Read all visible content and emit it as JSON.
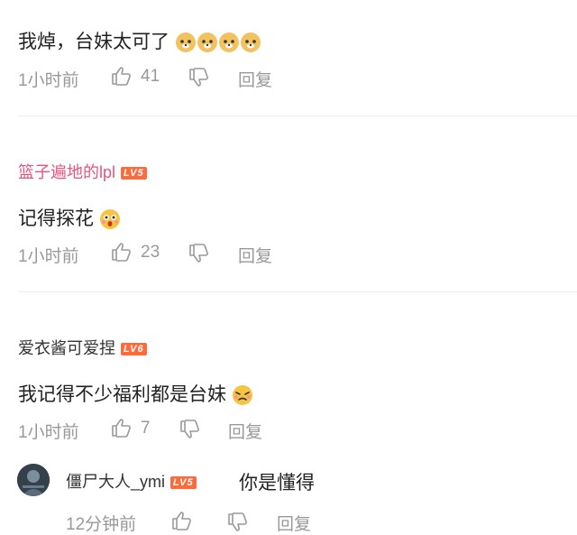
{
  "comments": [
    {
      "text": "我焯，台妹太可了",
      "time": "1小时前",
      "likes": "41",
      "reply": "回复"
    },
    {
      "user": "篮子遍地的lpl",
      "level": "LV5",
      "text": "记得探花",
      "time": "1小时前",
      "likes": "23",
      "reply": "回复"
    },
    {
      "user": "爱衣酱可爱捏",
      "level": "LV6",
      "text": "我记得不少福利都是台妹",
      "time": "1小时前",
      "likes": "7",
      "reply": "回复"
    }
  ],
  "sub_reply": {
    "user": "僵尸大人_ymi",
    "level": "LV5",
    "text": "你是懂得",
    "time": "12分钟前",
    "reply": "回复"
  },
  "colors": {
    "username_pink": "#e8547e",
    "level_badge": "#ff6a3d",
    "meta_gray": "#999999"
  }
}
